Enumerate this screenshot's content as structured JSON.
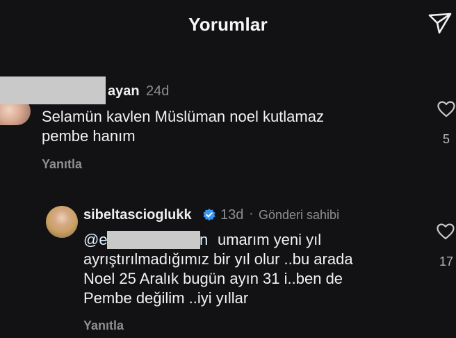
{
  "header": {
    "title": "Yorumlar",
    "share_icon": "send-paper-plane-icon"
  },
  "comments": [
    {
      "username_visible": "ayan",
      "time": "24d",
      "text_lines": [
        "Selamün kavlen Müslüman noel kutlamaz",
        "pembe hanım"
      ],
      "reply_label": "Yanıtla",
      "like_icon": "heart-outline-icon",
      "like_count": "5"
    },
    {
      "username": "sibeltascioglukk",
      "verified_icon": "verified-badge-icon",
      "verified_color": "#3897f0",
      "time": "13d",
      "separator": "·",
      "author_label": "Gönderi sahibi",
      "mention_start": "@e",
      "mention_end": "n",
      "text_first_line": "umarım yeni yıl",
      "text_lines": [
        "ayrıştırılmadığımız bir yıl olur ..bu arada",
        "Noel 25 Aralık bugün ayın 31 i..ben de",
        "Pembe değilim ..iyi yıllar"
      ],
      "reply_label": "Yanıtla",
      "like_icon": "heart-outline-icon",
      "like_count": "17"
    }
  ]
}
